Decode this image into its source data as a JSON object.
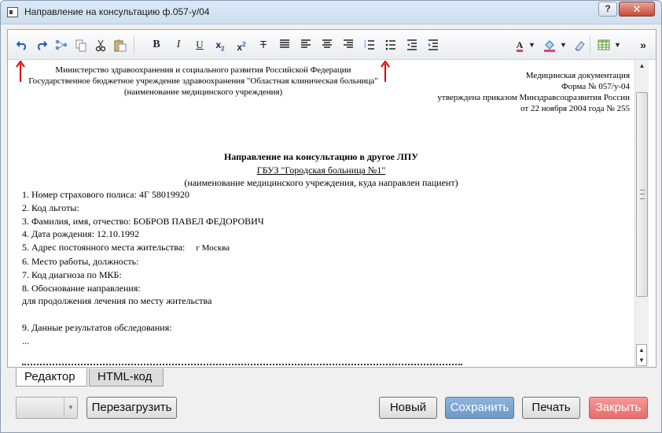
{
  "window": {
    "title": "Направление на консультацию ф.057-у/04",
    "help_label": "?",
    "close_label": "✕"
  },
  "toolbar": {
    "more_label": "»"
  },
  "document": {
    "header_left": [
      "Министерство здравоохранения и социального развития Российской Федерации",
      "Государственное бюджетное учреждение здравоохранения \"Областная клиническая больница\"",
      "(наименование медицинского учреждения)"
    ],
    "header_right": [
      "Медицинская документация",
      "Форма № 057/у-04",
      "утверждена приказом Минздравсоцразвития России",
      "от 22 ноября 2004 года № 255"
    ],
    "title": "Направление на консультацию в другое ЛПУ",
    "target_org": "ГБУЗ \"Городская больница №1\"",
    "target_caption": "(наименование медицинского учреждения, куда направлен пациент)",
    "fields": [
      {
        "label": "1. Номер страхового полиса: 4Г 58019920",
        "value": ""
      },
      {
        "label": "2. Код льготы:",
        "value": ""
      },
      {
        "label": "3. Фамилия, имя, отчество: БОБРОВ ПАВЕЛ ФЕДОРОВИЧ",
        "value": ""
      },
      {
        "label": "4. Дата рождения: 12.10.1992",
        "value": ""
      },
      {
        "label": "5. Адрес постоянного места жительства:",
        "value": "г Москва"
      },
      {
        "label": "6. Место работы, должность:",
        "value": ""
      },
      {
        "label": "7. Код диагноза по МКБ:",
        "value": ""
      },
      {
        "label": "8. Обоснование направления:",
        "value": ""
      },
      {
        "label": "для продолжения лечения по месту жительства",
        "value": ""
      },
      {
        "label": "",
        "value": ""
      },
      {
        "label": "9. Данные результатов обследования:",
        "value": ""
      },
      {
        "label": "...",
        "value": ""
      }
    ]
  },
  "tabs": [
    {
      "label": "Редактор",
      "active": true
    },
    {
      "label": "HTML-код",
      "active": false
    }
  ],
  "buttons": {
    "reload": "Перезагрузить",
    "new": "Новый",
    "save": "Сохранить",
    "print": "Печать",
    "close": "Закрыть"
  },
  "colors": {
    "save_button": "#7aa4d2",
    "close_button": "#ee7f7f",
    "annotation_arrow": "#e00000"
  }
}
